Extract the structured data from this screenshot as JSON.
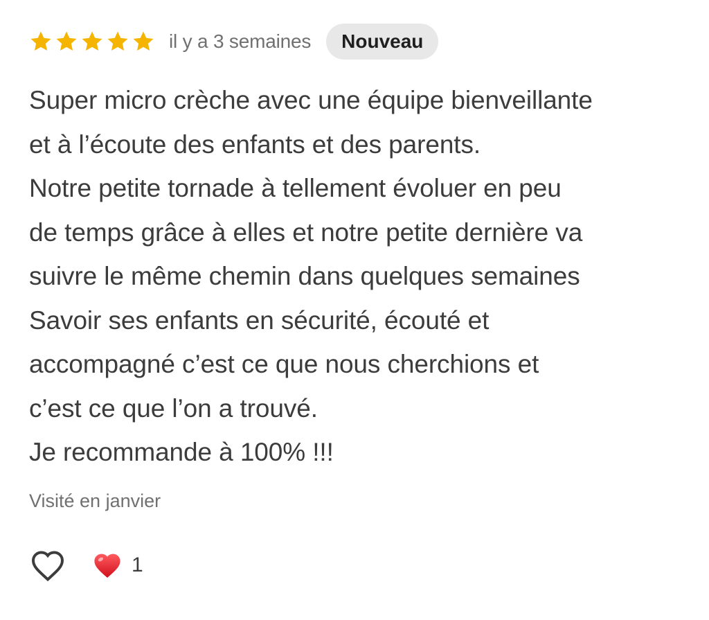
{
  "review": {
    "rating": 5,
    "rating_max": 5,
    "star_color": "#f4b400",
    "time_ago": "il y a 3 semaines",
    "badge": "Nouveau",
    "text_lines": [
      "Super micro crèche avec une équipe bienveillante",
      "et à l’écoute des enfants et des parents.",
      "Notre petite tornade à tellement évoluer en peu",
      "de temps grâce à elles et notre petite dernière va",
      "suivre le même chemin dans quelques semaines",
      "Savoir ses enfants en sécurité, écouté et",
      "accompagné c’est ce que nous cherchions et",
      "c’est ce que l’on a trouvé.",
      "Je recommande à 100% !!!"
    ],
    "visit": "Visité en janvier",
    "actions": {
      "like_icon": "heart-outline-icon",
      "reaction_icon": "red-heart-icon",
      "reaction_color": "#e8202a",
      "reaction_count": "1"
    }
  }
}
